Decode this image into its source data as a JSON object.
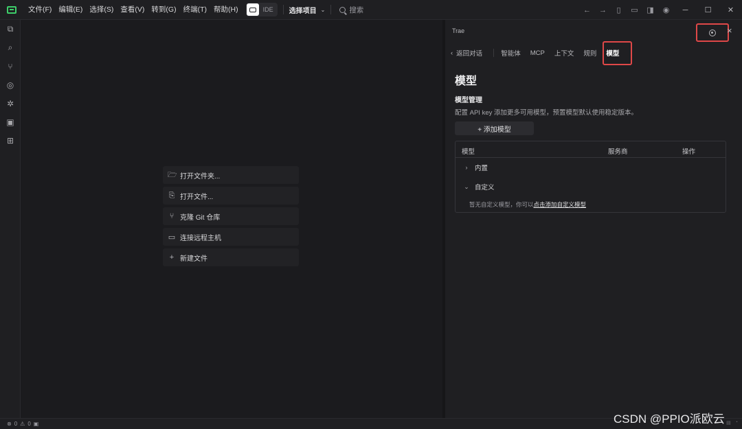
{
  "menu": [
    "文件(F)",
    "编辑(E)",
    "选择(S)",
    "查看(V)",
    "转到(G)",
    "终端(T)",
    "帮助(H)"
  ],
  "mode_label": "IDE",
  "project_select": "选择项目",
  "search_label": "搜索",
  "start_actions": [
    "打开文件夹...",
    "打开文件...",
    "克隆 Git 仓库",
    "连接远程主机",
    "新建文件"
  ],
  "panel": {
    "title": "Trae",
    "back_label": "返回对话",
    "tabs": [
      "智能体",
      "MCP",
      "上下文",
      "规则",
      "模型"
    ],
    "active_tab": "模型",
    "heading": "模型",
    "section_title": "模型管理",
    "description": "配置 API key 添加更多可用模型，预置模型默认使用稳定版本。",
    "add_button": "+ 添加模型",
    "table_headers": [
      "模型",
      "服务商",
      "操作"
    ],
    "groups": [
      {
        "label": "内置",
        "expanded": false
      },
      {
        "label": "自定义",
        "expanded": true
      }
    ],
    "empty_text": "暂无自定义模型，你可以",
    "empty_link": "点击添加自定义模型"
  },
  "status": {
    "errors": "0",
    "warnings": "0"
  },
  "watermark": "CSDN @PPIO派欧云"
}
